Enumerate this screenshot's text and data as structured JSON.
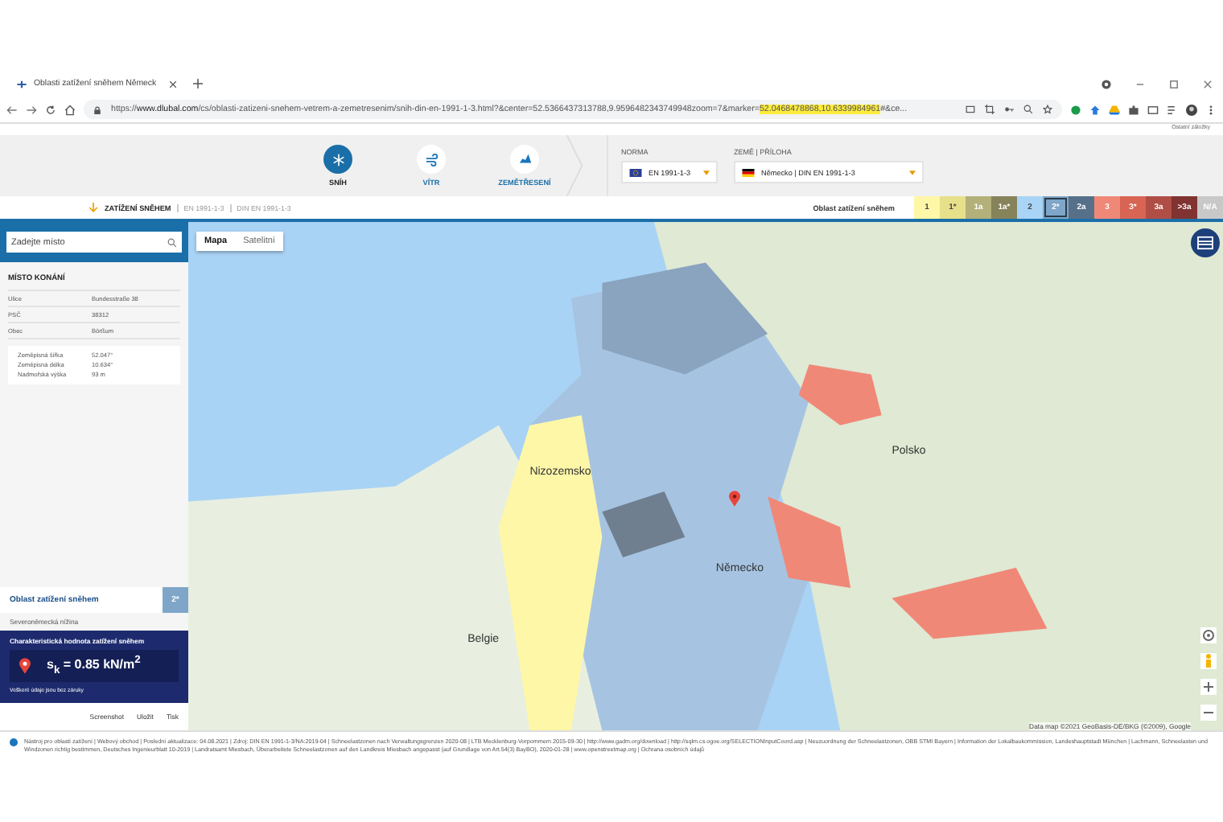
{
  "browser": {
    "tab_title": "Oblasti zatížení sněhem Německ",
    "url_prefix": "https://",
    "url_domain": "www.dlubal.com",
    "url_path": "/cs/oblasti-zatizeni-snehem-vetrem-a-zemetresenim/snih-din-en-1991-1-3.html?&center=52.5366437313788,9.9596482343749948zoom=7&marker=",
    "url_highlight": "52.0468478868,10.6339984961",
    "url_suffix": "#&ce...",
    "side_note": "Ostatní záložky"
  },
  "modes": [
    {
      "label": "SNÍH",
      "selected": true
    },
    {
      "label": "VÍTR",
      "selected": false
    },
    {
      "label": "ZEMĚTŘESENÍ",
      "selected": false
    }
  ],
  "selectors": [
    {
      "label": "NORMA",
      "value": "EN 1991-1-3",
      "kind": "eu"
    },
    {
      "label": "ZEMĚ | PŘÍLOHA",
      "value": "Německo | DIN EN 1991-1-3",
      "kind": "de"
    }
  ],
  "breadcrumb": {
    "title": "ZATÍŽENÍ SNĚHEM",
    "parts": [
      "EN 1991-1-3",
      "DIN EN 1991-1-3"
    ]
  },
  "legend": {
    "title": "Oblast zatížení sněhem",
    "zones": [
      {
        "label": "1",
        "color": "#fff7a8",
        "selected": false
      },
      {
        "label": "1*",
        "color": "#e6e08a",
        "selected": false
      },
      {
        "label": "1a",
        "color": "#b3b07a",
        "selected": false
      },
      {
        "label": "1a*",
        "color": "#86835a",
        "selected": false
      },
      {
        "label": "2",
        "color": "#a9d4f5",
        "selected": false
      },
      {
        "label": "2*",
        "color": "#7fa6c8",
        "selected": true
      },
      {
        "label": "2a",
        "color": "#57708a",
        "selected": false
      },
      {
        "label": "3",
        "color": "#f08878",
        "selected": false
      },
      {
        "label": "3*",
        "color": "#d86454",
        "selected": false
      },
      {
        "label": "3a",
        "color": "#b04e45",
        "selected": false
      },
      {
        "label": ">3a",
        "color": "#803330",
        "selected": false
      },
      {
        "label": "N/A",
        "color": "#c8c8c8",
        "selected": false
      }
    ]
  },
  "search": {
    "placeholder": "Zadejte místo"
  },
  "location": {
    "title": "MÍSTO KONÁNÍ",
    "rows": [
      {
        "label": "Ulice",
        "value": "Bundesstraße 38"
      },
      {
        "label": "PSČ",
        "value": "38312"
      },
      {
        "label": "Obec",
        "value": "Börßum"
      }
    ],
    "coords": [
      {
        "label": "Zeměpisná šířka",
        "value": "52.047°"
      },
      {
        "label": "Zeměpisná délka",
        "value": "10.634°"
      },
      {
        "label": "Nadmořská výška",
        "value": "93 m"
      }
    ]
  },
  "zone": {
    "label": "Oblast zatížení sněhem",
    "value": "2*",
    "region": "Severoněmecká nížina"
  },
  "result": {
    "title": "Charakteristická hodnota zatížení sněhem",
    "formula": "s$_{k}$ = 0.85 kN/m$^{2}$",
    "note": "Veškeré údaje jsou bez záruky"
  },
  "actions": [
    "Screenshot",
    "Uložit",
    "Tisk"
  ],
  "map": {
    "tabs": [
      {
        "label": "Mapa",
        "selected": true
      },
      {
        "label": "Satelitní",
        "selected": false
      }
    ],
    "labels": [
      "Polsko",
      "Německo",
      "Nizozemsko",
      "Belgie"
    ],
    "attribution": "Data map ©2021 GeoBasis-DE/BKG (©2009), Google"
  },
  "footer": "Nástroj pro oblasti zatížení | Webový obchod | Poslední aktualizace: 04.08.2021 | Zdroj: DIN EN 1991-1-3/NA:2019-04 | Schneelastzonen nach Verwaltungsgrenzen 2020-08 | LTB Mecklenburg-Vorpommern 2015-09-30 | http://www.gadm.org/download | http://sqlm.cs.ogoe.org/SELECTIONInputCoord.asp | Neuzuordnung der Schneelastzonen, OBB STMI Bayern | Information der Lokalbaukommission, Landeshauptstadt München | Lachmann, Schneelasten und Windzonen richtig bestimmen, Deutsches Ingenieurblatt 10-2019 | Landratsamt Miesbach, Überarbeitete Schneelastzonen auf den Landkreis Miesbach angepasst (auf Grundlage von Art.54(3) BayBO), 2020-01-28 | www.openstreetmap.org | Ochrana osobních údajů"
}
